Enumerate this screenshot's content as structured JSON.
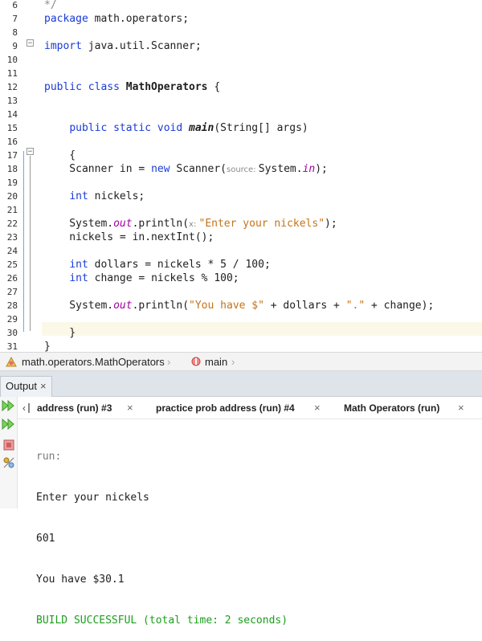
{
  "editor": {
    "lines": [
      {
        "num": "6",
        "tokens": [
          [
            "c",
            "*/"
          ]
        ]
      },
      {
        "num": "7",
        "tokens": [
          [
            "kw",
            "package"
          ],
          [
            "t",
            " math.operators;"
          ]
        ]
      },
      {
        "num": "8",
        "tokens": []
      },
      {
        "num": "9",
        "tokens": [
          [
            "kw",
            "import"
          ],
          [
            "t",
            " java.util.Scanner;"
          ]
        ]
      },
      {
        "num": "10",
        "tokens": []
      },
      {
        "num": "11",
        "tokens": []
      },
      {
        "num": "12",
        "tokens": [
          [
            "kw",
            "public class"
          ],
          [
            "t",
            " "
          ],
          [
            "bold",
            "MathOperators"
          ],
          [
            "t",
            " {"
          ]
        ]
      },
      {
        "num": "13",
        "tokens": []
      },
      {
        "num": "14",
        "tokens": []
      },
      {
        "num": "15",
        "tokens": [
          [
            "t",
            "    "
          ],
          [
            "kw",
            "public static void"
          ],
          [
            "t",
            " "
          ],
          [
            "bi",
            "main"
          ],
          [
            "t",
            "(String[] args)"
          ]
        ]
      },
      {
        "num": "16",
        "tokens": []
      },
      {
        "num": "17",
        "tokens": [
          [
            "t",
            "    {"
          ]
        ]
      },
      {
        "num": "18",
        "tokens": [
          [
            "t",
            "    Scanner in = "
          ],
          [
            "kw",
            "new"
          ],
          [
            "t",
            " Scanner("
          ],
          [
            "hint",
            "source: "
          ],
          [
            "t",
            "System."
          ],
          [
            "fld",
            "in"
          ],
          [
            "t",
            ");"
          ]
        ]
      },
      {
        "num": "19",
        "tokens": []
      },
      {
        "num": "20",
        "tokens": [
          [
            "t",
            "    "
          ],
          [
            "kw",
            "int"
          ],
          [
            "t",
            " nickels;"
          ]
        ]
      },
      {
        "num": "21",
        "tokens": []
      },
      {
        "num": "22",
        "tokens": [
          [
            "t",
            "    System."
          ],
          [
            "fld",
            "out"
          ],
          [
            "t",
            ".println("
          ],
          [
            "hint",
            "x: "
          ],
          [
            "str",
            "\"Enter your nickels\""
          ],
          [
            "t",
            ");"
          ]
        ]
      },
      {
        "num": "23",
        "tokens": [
          [
            "t",
            "    nickels = in.nextInt();"
          ]
        ]
      },
      {
        "num": "24",
        "tokens": []
      },
      {
        "num": "25",
        "tokens": [
          [
            "t",
            "    "
          ],
          [
            "kw",
            "int"
          ],
          [
            "t",
            " dollars = nickels * 5 / 100;"
          ]
        ]
      },
      {
        "num": "26",
        "tokens": [
          [
            "t",
            "    "
          ],
          [
            "kw",
            "int"
          ],
          [
            "t",
            " change = nickels % 100;"
          ]
        ]
      },
      {
        "num": "27",
        "tokens": []
      },
      {
        "num": "28",
        "tokens": [
          [
            "t",
            "    System."
          ],
          [
            "fld",
            "out"
          ],
          [
            "t",
            ".println("
          ],
          [
            "str",
            "\"You have $\""
          ],
          [
            "t",
            " + dollars + "
          ],
          [
            "str",
            "\".\""
          ],
          [
            "t",
            " + change);"
          ]
        ]
      },
      {
        "num": "29",
        "tokens": []
      },
      {
        "num": "30",
        "tokens": [
          [
            "t",
            "    }"
          ]
        ]
      },
      {
        "num": "31",
        "tokens": [
          [
            "t",
            "}"
          ]
        ]
      }
    ]
  },
  "navbar": {
    "class_crumb": "math.operators.MathOperators",
    "method_crumb": "main"
  },
  "output": {
    "panel_title": "Output",
    "tabs": [
      {
        "label": "address (run) #3"
      },
      {
        "label": "practice prob address (run) #4"
      },
      {
        "label": "Math Operators (run)"
      }
    ],
    "console": {
      "run": "run:",
      "prompt": "Enter your nickels",
      "input": "601",
      "result": "You have $30.1",
      "status": "BUILD SUCCESSFUL (total time: 2 seconds)"
    }
  },
  "colors": {
    "keyword": "#1a3bd6",
    "string": "#c4731a",
    "field": "#a000a0",
    "success": "#1c9e1c",
    "current_line": "#fbf8e8"
  },
  "icons": [
    "collapse-icon",
    "expand-icon",
    "class-icon",
    "method-icon",
    "close-icon",
    "rerun-icon",
    "stop-icon",
    "settings-icon"
  ]
}
